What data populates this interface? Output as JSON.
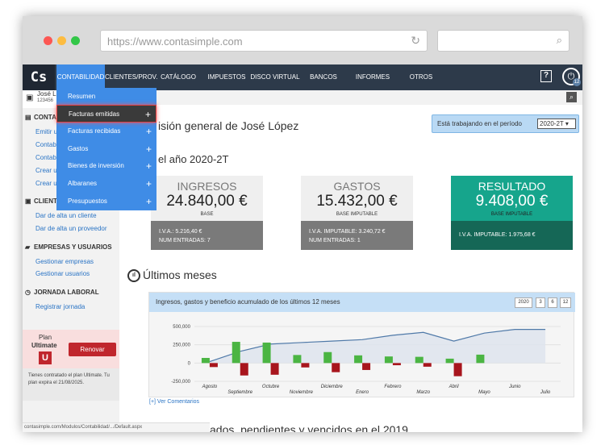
{
  "browser": {
    "url": "https://www.contasimple.com"
  },
  "nav": {
    "logo": "Cs",
    "items": [
      "CONTABILIDAD",
      "CLIENTES/PROV.",
      "CATÁLOGO",
      "IMPUESTOS",
      "DISCO VIRTUAL",
      "BANCOS",
      "INFORMES",
      "OTROS"
    ],
    "help": "?",
    "user_badge": "12"
  },
  "user": {
    "name": "José Lo",
    "id": "123456"
  },
  "sidebar": {
    "sections": [
      {
        "title": "CONTA",
        "links": [
          "Emitir u",
          "Contab",
          "Contab",
          "Crear u",
          "Crear u"
        ]
      },
      {
        "title": "CLIENT",
        "links": [
          "Dar de alta un cliente",
          "Dar de alta un proveedor"
        ]
      },
      {
        "title": "EMPRESAS Y USUARIOS",
        "links": [
          "Gestionar empresas",
          "Gestionar usuarios"
        ]
      },
      {
        "title": "JORNADA LABORAL",
        "links": [
          "Registrar jornada"
        ]
      }
    ],
    "plan": {
      "label": "Plan",
      "name": "Ultimate",
      "badge": "U",
      "button": "Renovar"
    },
    "expire": "Tienes contratado el plan Ultimate. Tu plan expira el 21/08/2025."
  },
  "dropdown": {
    "items": [
      {
        "label": "Resumen",
        "plus": false
      },
      {
        "label": "Facturas emitidas",
        "plus": true
      },
      {
        "label": "Facturas recibidas",
        "plus": true
      },
      {
        "label": "Gastos",
        "plus": true
      },
      {
        "label": "Bienes de inversión",
        "plus": true
      },
      {
        "label": "Albaranes",
        "plus": true
      },
      {
        "label": "Presupuestos",
        "plus": true
      }
    ],
    "highlighted": "Facturas emitidas"
  },
  "breadcrumb": "pal",
  "main": {
    "title": "isión general de José López",
    "period_label": "Está trabajando en el período",
    "period_value": "2020-2T",
    "year_heading": "el año 2020-2T",
    "cards": [
      {
        "label": "INGRESOS",
        "value": "24.840,00 €",
        "sub": "BASE",
        "foot1": "I.V.A.: 5.216,40 €",
        "foot2": "NUM ENTRADAS: 7"
      },
      {
        "label": "GASTOS",
        "value": "15.432,00 €",
        "sub": "BASE IMPUTABLE",
        "foot1": "I.V.A. IMPUTABLE: 3.240,72 €",
        "foot2": "NUM ENTRADAS: 1"
      },
      {
        "label": "RESULTADO",
        "value": "9.408,00 €",
        "sub": "BASE IMPUTABLE",
        "foot1": "I.V.A. IMPUTABLE: 1.975,68 €",
        "foot2": ""
      }
    ],
    "months_heading": "Últimos meses",
    "months_icon": "chart-icon",
    "ver_comentarios": "[+] Ver Comentarios",
    "cut_heading": "ados, pendientes y vencidos en el 2019"
  },
  "statusbar": "contasimple.com/Modulos/Contabilidad/.../Default.aspx",
  "colors": {
    "nav": "#2d3a4a",
    "accent": "#3f8ce6",
    "green": "#4bb543",
    "red": "#a8151d",
    "line": "#4f79a8"
  },
  "chart_data": {
    "type": "bar",
    "title": "Ingresos, gastos y beneficio acumulado de los últimos 12 meses",
    "range_buttons": [
      "2020",
      "3",
      "6",
      "12"
    ],
    "categories": [
      "Agosto",
      "Septiembre",
      "Octubre",
      "Noviembre",
      "Diciembre",
      "Enero",
      "Febrero",
      "Marzo",
      "Abril",
      "Mayo",
      "Junio",
      "Julio"
    ],
    "yticks": [
      "500,000",
      "250,000",
      "0",
      "-250,000"
    ],
    "ylim": [
      -250000,
      500000
    ],
    "series": [
      {
        "name": "Ingresos",
        "values": [
          70000,
          290000,
          280000,
          110000,
          150000,
          105000,
          90000,
          85000,
          60000,
          115000,
          0,
          0
        ]
      },
      {
        "name": "Gastos",
        "values": [
          -55000,
          -170000,
          -160000,
          -60000,
          -125000,
          -95000,
          -30000,
          -50000,
          -180000,
          0,
          0,
          0
        ]
      },
      {
        "name": "Beneficio acumulado",
        "values": [
          20000,
          160000,
          260000,
          280000,
          300000,
          320000,
          380000,
          420000,
          300000,
          410000,
          460000,
          460000
        ]
      }
    ]
  }
}
